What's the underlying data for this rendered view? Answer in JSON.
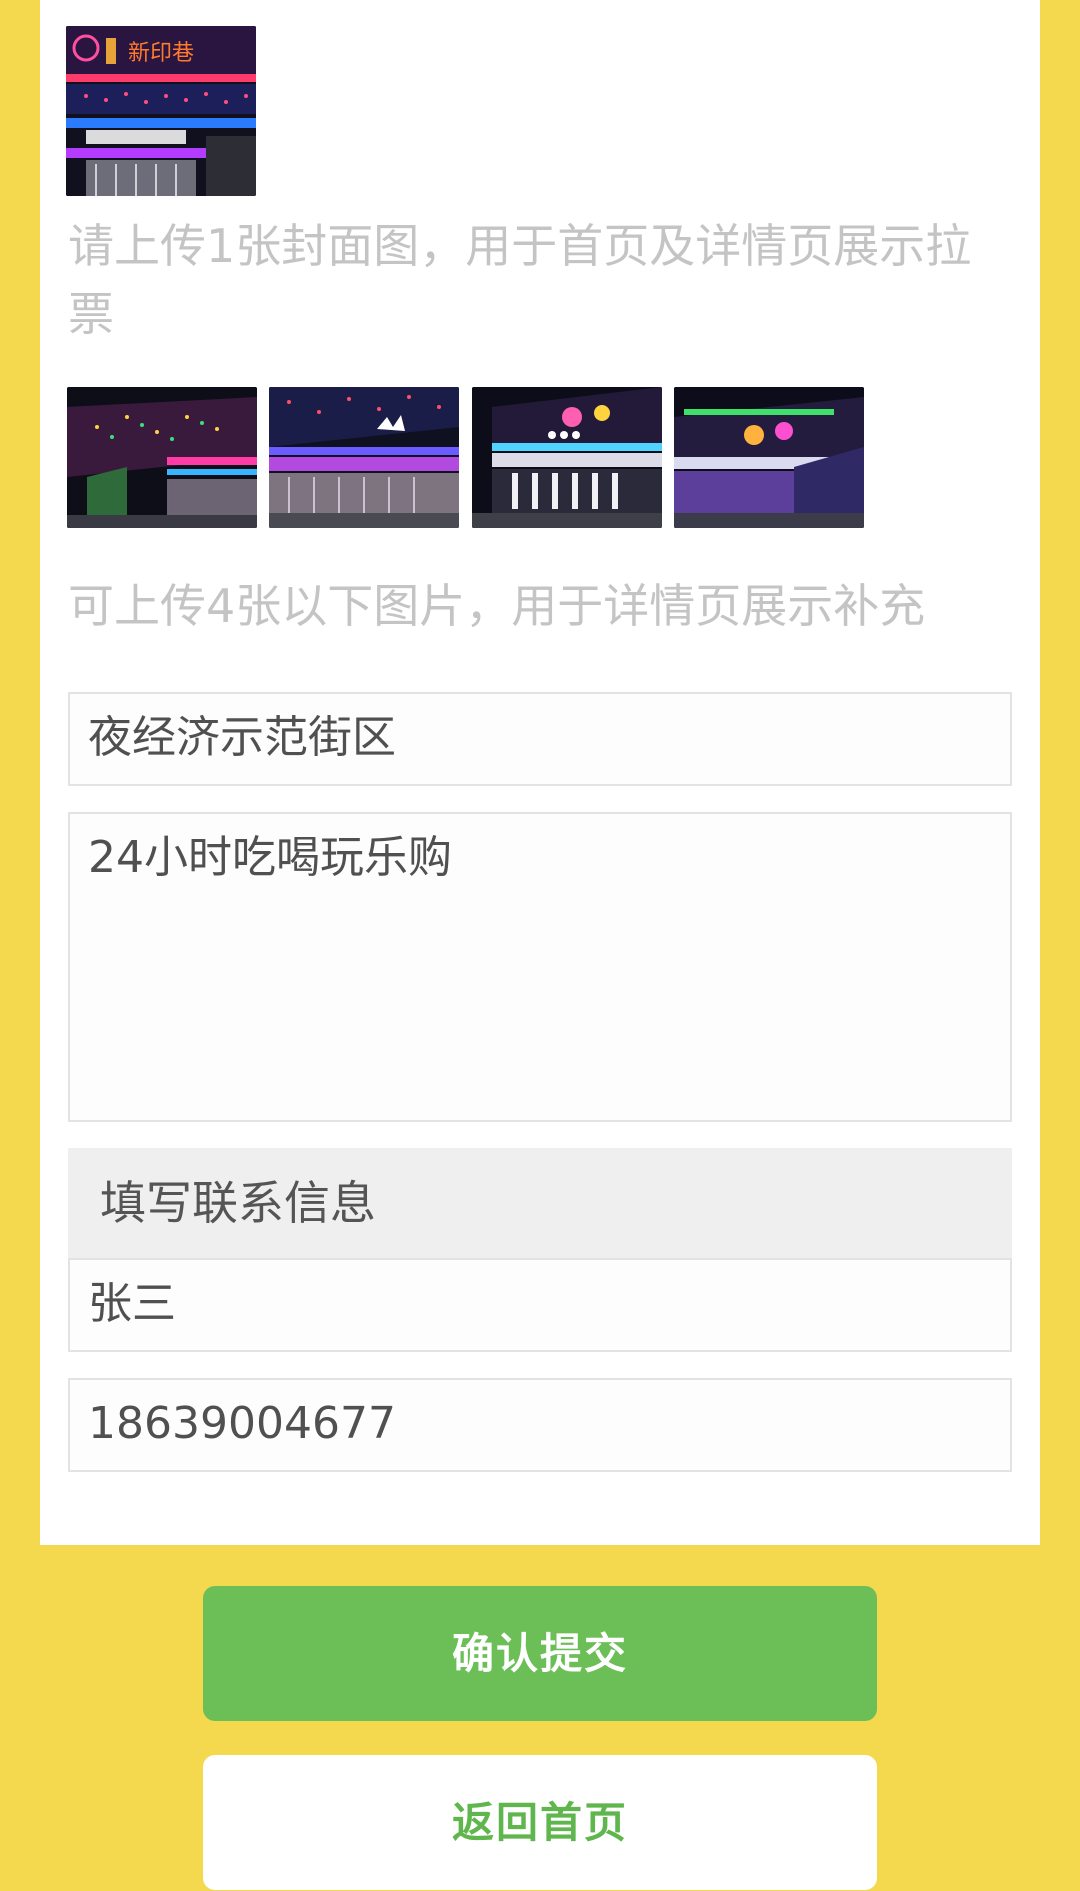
{
  "upload_cover": {
    "hint": "请上传1张封面图，用于首页及详情页展示拉票",
    "image_sign_text": "新印巷"
  },
  "upload_extra": {
    "hint": "可上传4张以下图片，用于详情页展示补充",
    "images": [
      "gallery-image-1",
      "gallery-image-2",
      "gallery-image-3",
      "gallery-image-4"
    ]
  },
  "form": {
    "title_value": "夜经济示范街区",
    "description_value": "24小时吃喝玩乐购"
  },
  "contact": {
    "section_title": "填写联系信息",
    "name_value": "张三",
    "phone_value": "18639004677"
  },
  "actions": {
    "submit_label": "确认提交",
    "home_label": "返回首页"
  },
  "colors": {
    "page_background": "#f4d94e",
    "primary_button": "#6cbe57",
    "secondary_button_text": "#5fb64c",
    "hint_text": "#c4c4c4"
  }
}
